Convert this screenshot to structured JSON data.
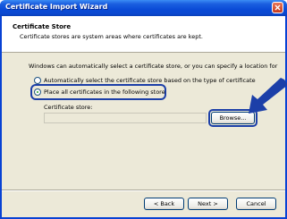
{
  "window": {
    "title": "Certificate Import Wizard",
    "close_icon": "close-icon"
  },
  "header": {
    "title": "Certificate Store",
    "description": "Certificate stores are system areas where certificates are kept."
  },
  "body": {
    "intro": "Windows can automatically select a certificate store, or you can specify a location for",
    "options": [
      {
        "label": "Automatically select the certificate store based on the type of certificate",
        "selected": false
      },
      {
        "label": "Place all certificates in the following store",
        "selected": true
      }
    ],
    "store_label": "Certificate store:",
    "store_value": "",
    "browse_label": "Browse..."
  },
  "footer": {
    "back_label": "< Back",
    "next_label": "Next >",
    "cancel_label": "Cancel"
  },
  "colors": {
    "title_bar": "#0a4ad6",
    "highlight_ring": "#1c3fa8",
    "arrow": "#1c3fa8"
  }
}
